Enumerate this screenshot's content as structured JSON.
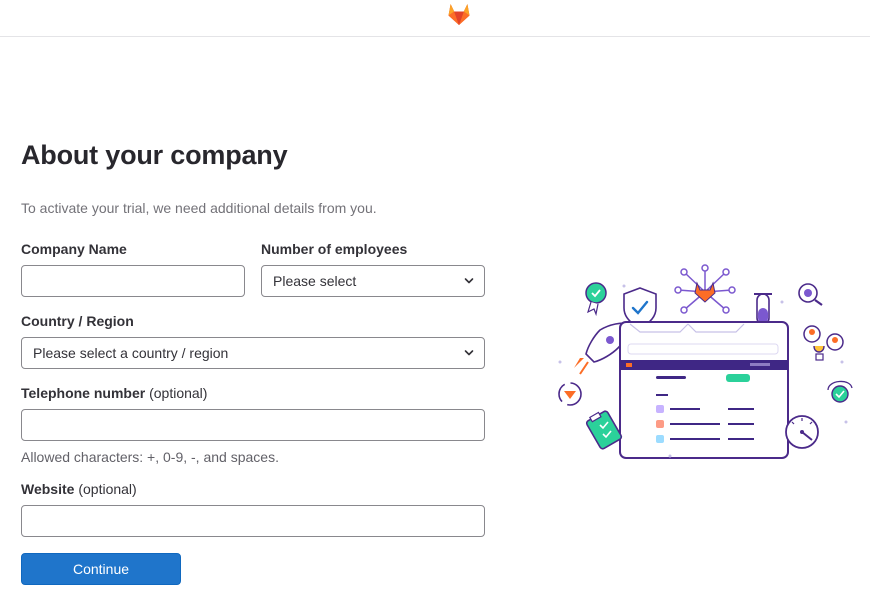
{
  "header": {
    "logo_icon": "gitlab-tanuki-icon"
  },
  "form": {
    "title": "About your company",
    "subtitle": "To activate your trial, we need additional details from you.",
    "company_name": {
      "label": "Company Name",
      "value": "",
      "placeholder": ""
    },
    "employees": {
      "label": "Number of employees",
      "selected": "Please select"
    },
    "country": {
      "label": "Country / Region",
      "selected": "Please select a country / region"
    },
    "telephone": {
      "label": "Telephone number",
      "optional": "(optional)",
      "value": "",
      "help": "Allowed characters: +, 0-9, -, and spaces."
    },
    "website": {
      "label": "Website",
      "optional": "(optional)",
      "value": ""
    },
    "submit_label": "Continue"
  },
  "colors": {
    "primary_button": "#1f75cb",
    "illustration_purple": "#7b58cf",
    "illustration_orange": "#fc6d26",
    "illustration_teal": "#2bd19a"
  }
}
